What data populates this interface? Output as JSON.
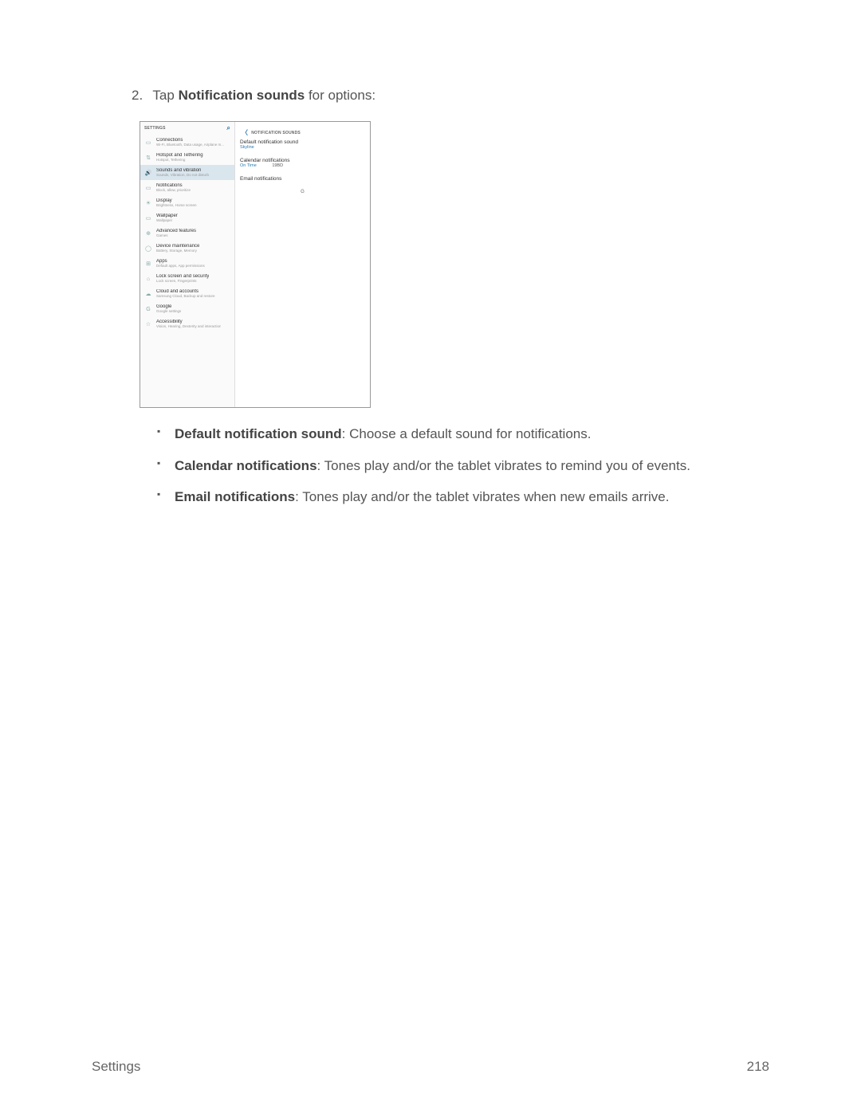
{
  "step": {
    "number": "2.",
    "prefix": "Tap ",
    "bold": "Notification sounds",
    "suffix": " for options:"
  },
  "shot": {
    "left_header": "SETTINGS",
    "right_header": "NOTIFICATION SOUNDS",
    "items": [
      {
        "icon": "▭",
        "title": "Connections",
        "desc": "Wi-Fi, Bluetooth, Data usage, Airplane m..."
      },
      {
        "icon": "⇅",
        "title": "Hotspot and Tethering",
        "desc": "Hotspot, Tethering"
      },
      {
        "icon": "🔊",
        "title": "Sounds and vibration",
        "desc": "Sounds, Vibration, Do not disturb",
        "selected": true
      },
      {
        "icon": "▭",
        "title": "Notifications",
        "desc": "Block, allow, prioritize"
      },
      {
        "icon": "☀",
        "title": "Display",
        "desc": "Brightness, Home screen"
      },
      {
        "icon": "▭",
        "title": "Wallpaper",
        "desc": "Wallpaper"
      },
      {
        "icon": "⊕",
        "title": "Advanced features",
        "desc": "Games"
      },
      {
        "icon": "◯",
        "title": "Device maintenance",
        "desc": "Battery, Storage, Memory"
      },
      {
        "icon": "⊞",
        "title": "Apps",
        "desc": "Default apps, App permissions"
      },
      {
        "icon": "⌂",
        "title": "Lock screen and security",
        "desc": "Lock screen, Fingerprints"
      },
      {
        "icon": "☁",
        "title": "Cloud and accounts",
        "desc": "Samsung Cloud, Backup and restore"
      },
      {
        "icon": "G",
        "title": "Google",
        "desc": "Google settings"
      },
      {
        "icon": "☆",
        "title": "Accessibility",
        "desc": "Vision, Hearing, Dexterity and interaction"
      }
    ],
    "right_items": [
      {
        "title": "Default notification sound",
        "value": "Skyline"
      },
      {
        "title": "Calendar notifications",
        "value": "On Time",
        "extra": "19BD"
      },
      {
        "title": "Email notifications",
        "value": ""
      }
    ],
    "right_middle": "G"
  },
  "bullets": [
    {
      "bold": "Default notification sound",
      "text": ": Choose a default sound for notifications."
    },
    {
      "bold": "Calendar notifications",
      "text": ": Tones play and/or the tablet vibrates to remind you of events."
    },
    {
      "bold": "Email notifications",
      "text": ": Tones play and/or the tablet vibrates when new emails arrive."
    }
  ],
  "footer": {
    "left": "Settings",
    "right": "218"
  }
}
